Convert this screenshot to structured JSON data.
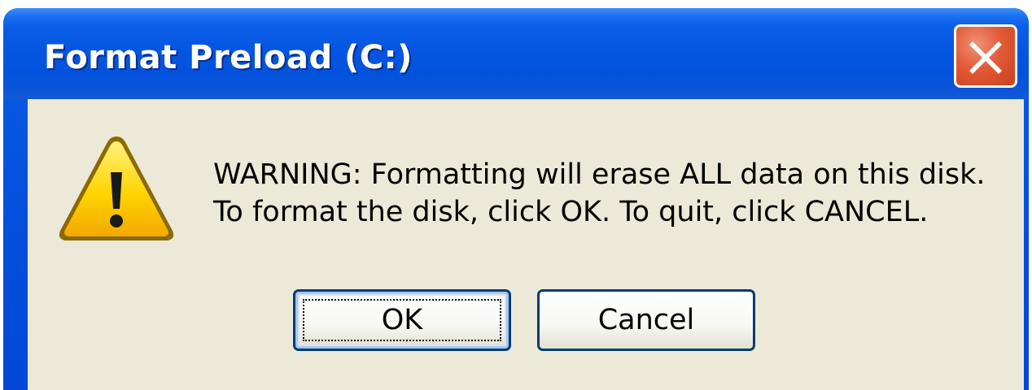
{
  "window": {
    "title": "Format Preload (C:)",
    "close_icon": "close-icon"
  },
  "message": {
    "icon": "warning-icon",
    "line1": "WARNING: Formatting will erase ALL data on this disk.",
    "line2": "To format the disk, click OK. To quit, click CANCEL."
  },
  "buttons": {
    "ok_label": "OK",
    "cancel_label": "Cancel"
  },
  "colors": {
    "titlebar": "#0455e2",
    "client_bg": "#ece9d8",
    "close_button": "#e25a36",
    "warning_fill": "#ffd200"
  }
}
